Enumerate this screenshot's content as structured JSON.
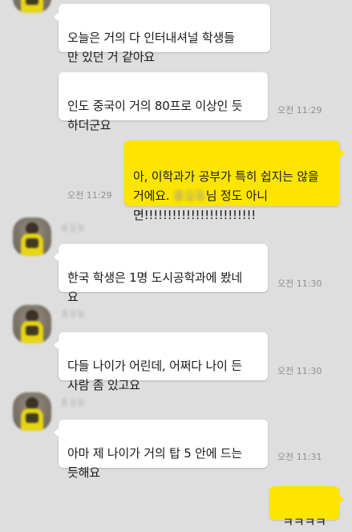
{
  "messages": [
    {
      "id": "m1",
      "direction": "incoming",
      "text": "오늘은 거의 다 인터내셔널 학생들\n만 있던 거 같아요",
      "time": ""
    },
    {
      "id": "m2",
      "direction": "incoming",
      "text": "인도 중국이 거의 80프로 이상인 듯\n하더군요",
      "time": "오전 11:29"
    },
    {
      "id": "m3",
      "direction": "outgoing",
      "text_before": "아, 이학과가 공부가 특히 쉽지는 않을\n거에요. ",
      "blurred_name": "홍길동",
      "text_after": "님 정도 아니\n면!!!!!!!!!!!!!!!!!!!!!!!!",
      "time": "오전 11:29"
    },
    {
      "id": "m4",
      "direction": "incoming",
      "sender": "홍길동",
      "text": "한국 학생은 1명 도시공학과에 봤네\n요",
      "time": "오전 11:30"
    },
    {
      "id": "m5",
      "direction": "incoming",
      "sender": "홍길동",
      "text": "다들 나이가 어린데, 어쩌다 나이 든\n사람 좀 있고요",
      "time": "오전 11:30"
    },
    {
      "id": "m6",
      "direction": "incoming",
      "sender": "홍길동",
      "text": "아마 제 나이가 거의 탑 5 안에 드는\n듯해요",
      "time": "오전 11:31"
    },
    {
      "id": "m7",
      "direction": "outgoing",
      "text": "ㅋㅋㅋㅋ",
      "time": ""
    }
  ],
  "colors": {
    "background": "#dedede",
    "incoming_bubble": "#ffffff",
    "outgoing_bubble": "#fee500",
    "timestamp": "#8f8f8f"
  }
}
